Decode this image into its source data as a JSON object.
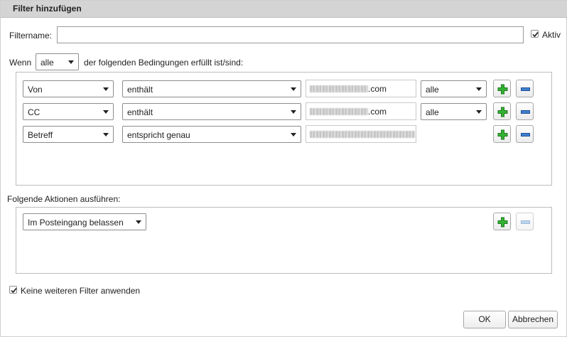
{
  "dialog": {
    "title": "Filter hinzufügen",
    "filtername_label": "Filtername:",
    "filtername_value": "",
    "active_label": "Aktiv",
    "active_checked": true
  },
  "conditions": {
    "prefix": "Wenn",
    "match_select": "alle",
    "suffix": "der folgenden Bedingungen erfüllt ist/sind:",
    "rows": [
      {
        "field": "Von",
        "operator": "enthält",
        "value_suffix": ".com",
        "scope": "alle"
      },
      {
        "field": "CC",
        "operator": "enthält",
        "value_suffix": ".com",
        "scope": "alle"
      },
      {
        "field": "Betreff",
        "operator": "entspricht genau",
        "value_suffix": ""
      }
    ]
  },
  "actions": {
    "label": "Folgende Aktionen ausführen:",
    "rows": [
      {
        "action": "Im Posteingang belassen"
      }
    ]
  },
  "stop_processing": {
    "label": "Keine weiteren Filter anwenden",
    "checked": true
  },
  "buttons": {
    "ok": "OK",
    "cancel": "Abbrechen"
  },
  "icons": {
    "add": "plus-icon",
    "remove": "minus-icon",
    "dropdown": "chevron-down-icon",
    "check": "checkmark-icon"
  },
  "colors": {
    "add_green": "#2ea82e",
    "remove_blue": "#3b74c4",
    "titlebar": "#d4d4d4"
  }
}
